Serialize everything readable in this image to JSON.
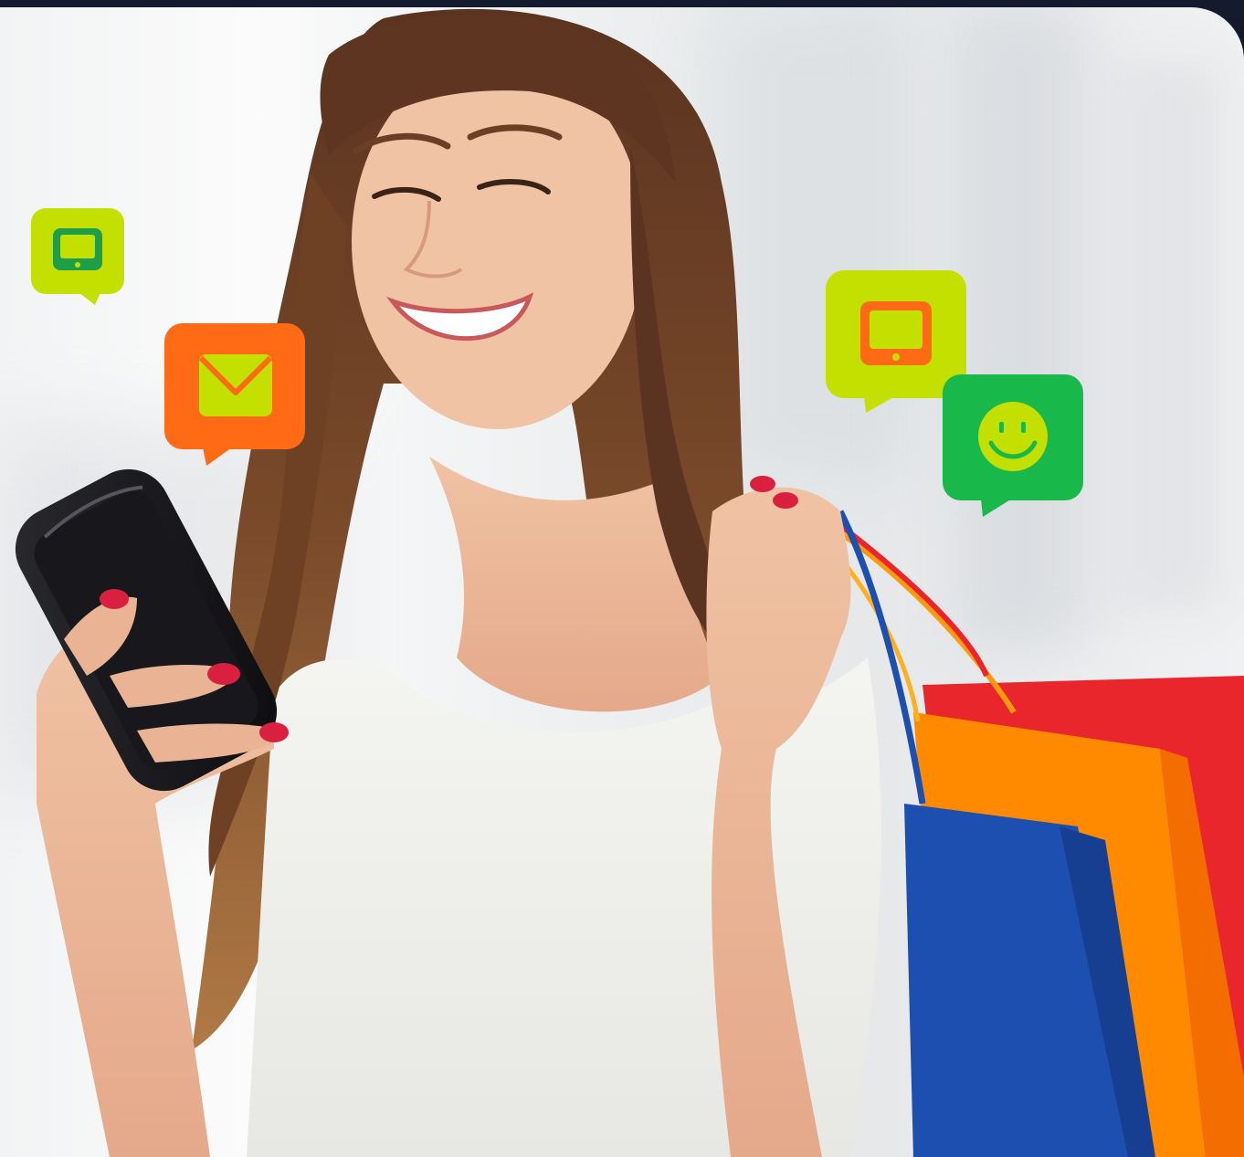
{
  "photo": {
    "subject": "woman-with-phone-and-shopping-bags",
    "icons": [
      {
        "name": "tablet-icon",
        "bubble_color": "#c4e000",
        "glyph_color": "#1f9e4a"
      },
      {
        "name": "mail-icon",
        "bubble_color": "#ff6a14",
        "glyph_color": "#c4e000"
      },
      {
        "name": "tablet-icon",
        "bubble_color": "#c4e000",
        "glyph_color": "#ff6a14"
      },
      {
        "name": "smiley-icon",
        "bubble_color": "#19b84a",
        "glyph_color": "#c4e000"
      }
    ],
    "colors": {
      "frame": "#141a2b",
      "bag_red": "#e8262c",
      "bag_orange": "#ff8a00",
      "bag_blue": "#1d4fb0"
    }
  }
}
